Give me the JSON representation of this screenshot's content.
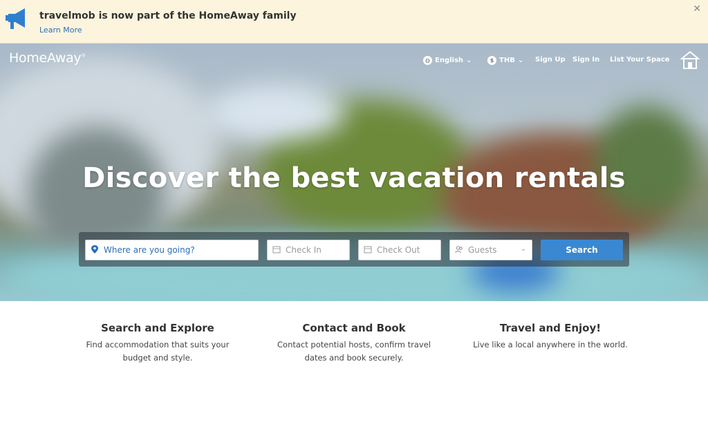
{
  "banner": {
    "title": "travelmob is now part of the HomeAway family",
    "learn_more": "Learn More",
    "close_symbol": "✕"
  },
  "header": {
    "logo": "HomeAway",
    "logo_mark": "®",
    "language": "English",
    "currency": "THB",
    "sign_up": "Sign Up",
    "sign_in": "Sign In",
    "list_space": "List Your Space"
  },
  "hero": {
    "headline": "Discover the best vacation rentals"
  },
  "search": {
    "where_placeholder": "Where are you going?",
    "check_in": "Check In",
    "check_out": "Check Out",
    "guests": "Guests",
    "button": "Search"
  },
  "features": [
    {
      "title": "Search and Explore",
      "line1": "Find accommodation that suits your",
      "line2": "budget and style."
    },
    {
      "title": "Contact and Book",
      "line1": "Contact potential hosts, confirm travel",
      "line2": "dates and book securely."
    },
    {
      "title": "Travel and Enjoy!",
      "line1": "Live like a local anywhere in the world.",
      "line2": ""
    }
  ],
  "colors": {
    "banner_bg": "#fcf4dd",
    "accent": "#3a88d1",
    "link": "#2a6ebb"
  }
}
